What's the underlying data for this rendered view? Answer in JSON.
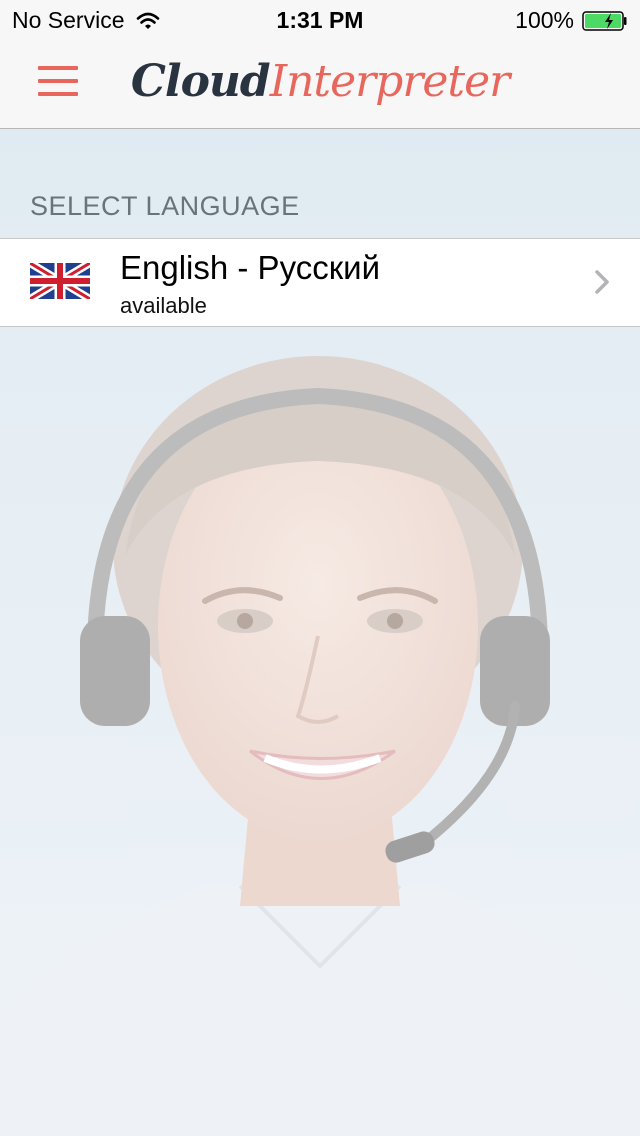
{
  "status_bar": {
    "carrier": "No Service",
    "time": "1:31 PM",
    "battery": "100%",
    "battery_level": 1.0,
    "battery_color": "#4cd964"
  },
  "nav": {
    "logo_part1": "Cloud",
    "logo_part2": "Interpreter",
    "accent_color": "#e8675d",
    "menu_icon": "hamburger-menu-icon"
  },
  "section": {
    "header": "SELECT LANGUAGE"
  },
  "languages": [
    {
      "title": "English - Русский",
      "status": "available",
      "flag_icon": "uk-flag-icon",
      "chevron_icon": "chevron-right-icon"
    }
  ],
  "background": {
    "image_subject": "support operator with headset"
  }
}
